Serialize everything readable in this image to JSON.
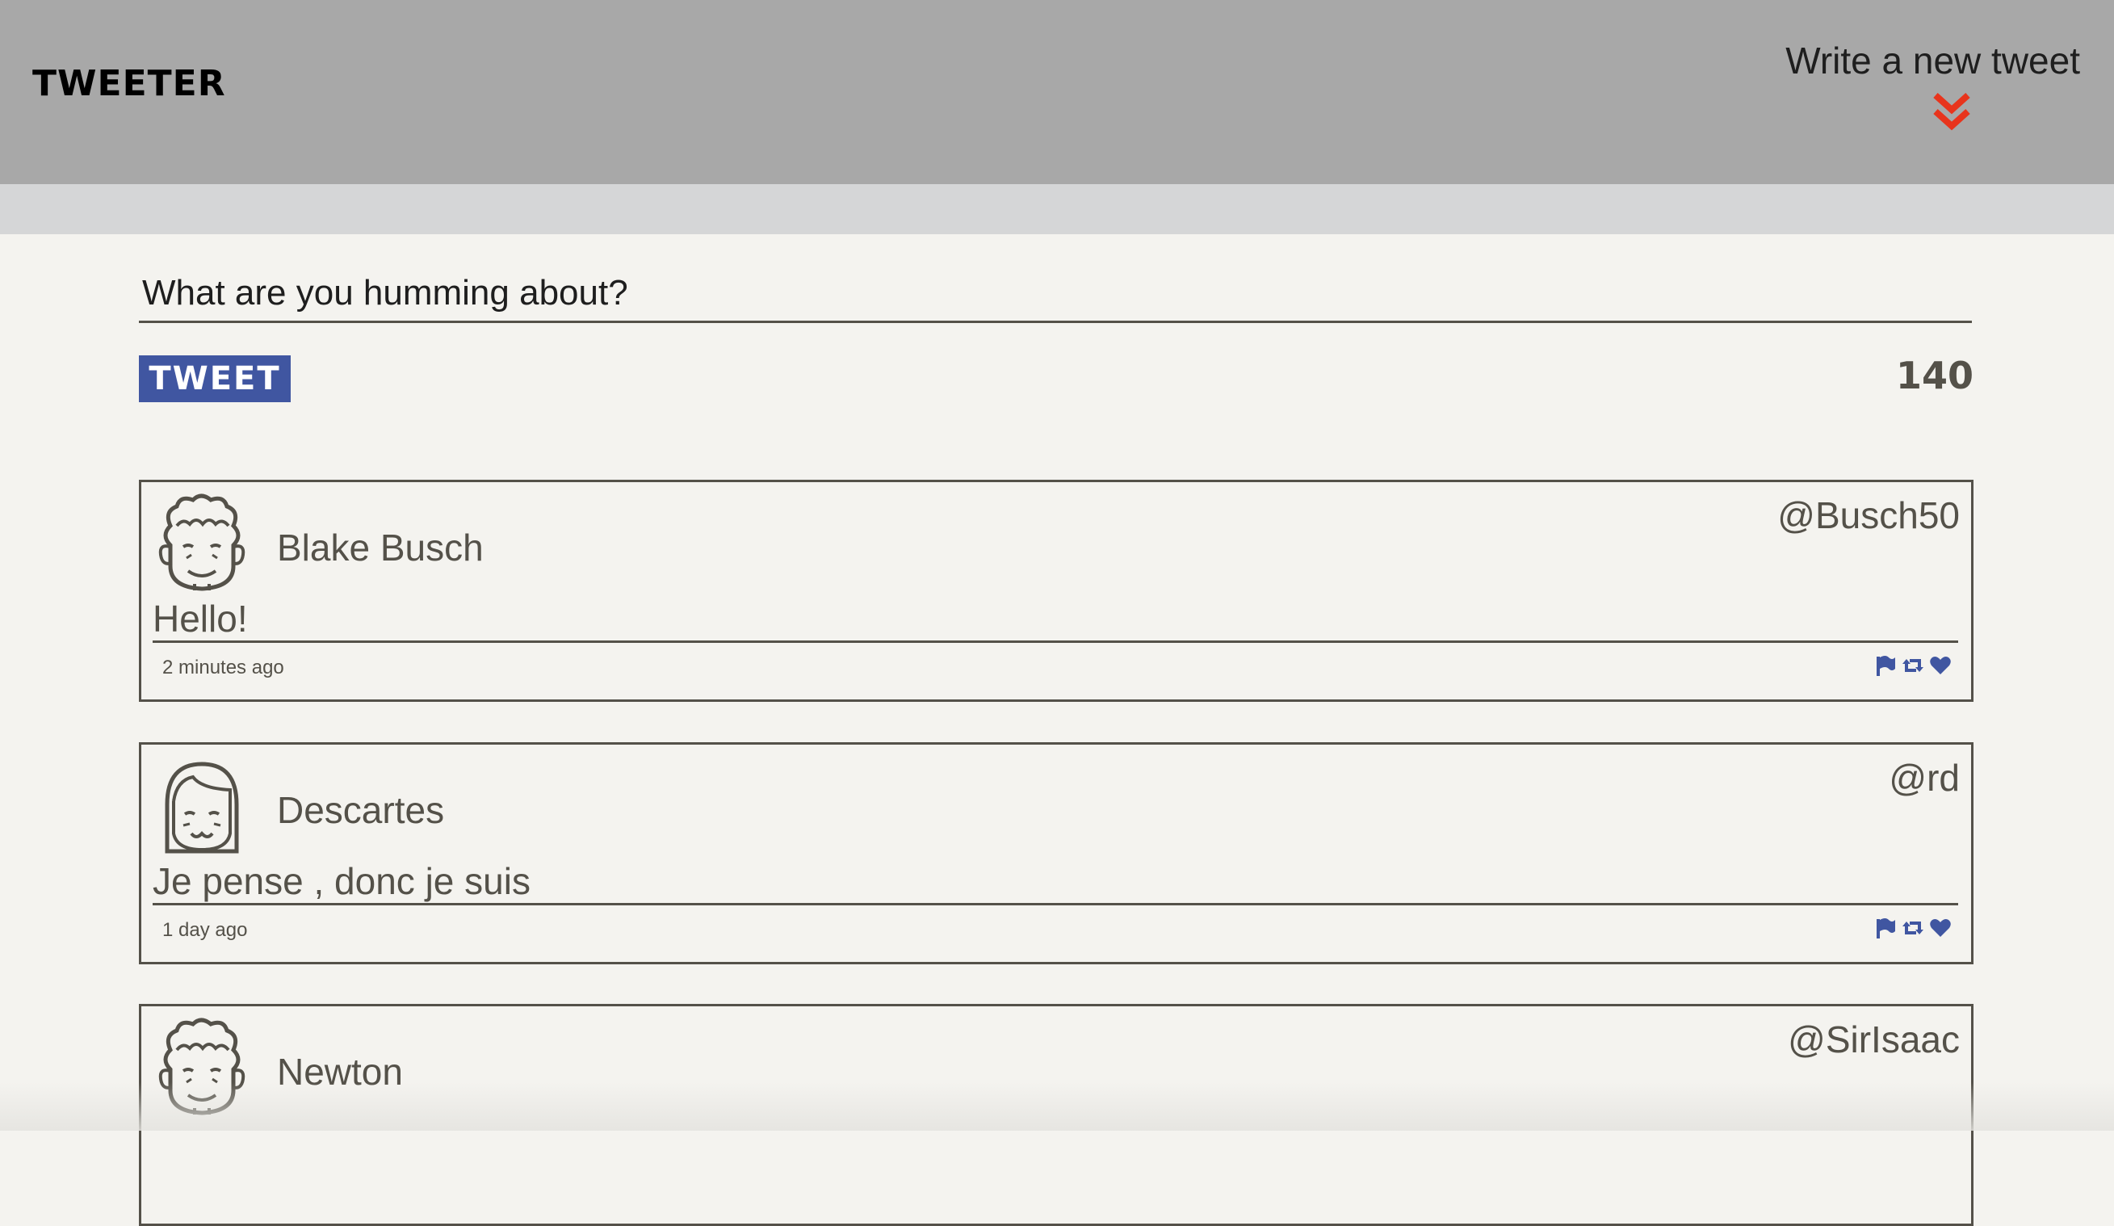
{
  "navbar": {
    "brand": "TWEETER",
    "compose_label": "Write a new tweet",
    "compose_icon": "double-chevron-down-icon",
    "accent_color": "#e8341c",
    "background": "#a8a8a8"
  },
  "new_tweet": {
    "placeholder": "What are you humming about?",
    "button_label": "TWEET",
    "counter": "140",
    "button_color": "#4056a1"
  },
  "tweets": [
    {
      "name": "Blake Busch",
      "handle": "@Busch50",
      "content": "Hello!",
      "time": "2 minutes ago",
      "avatar": "curly-hair-avatar-icon"
    },
    {
      "name": "Descartes",
      "handle": "@rd",
      "content": "Je pense , donc je suis",
      "time": "1 day ago",
      "avatar": "bob-hair-avatar-icon"
    },
    {
      "name": "Newton",
      "handle": "@SirIsaac",
      "content": "",
      "time": "",
      "avatar": "curly-hair-avatar-icon"
    }
  ],
  "actions": {
    "flag": "flag-icon",
    "retweet": "retweet-icon",
    "like": "heart-icon",
    "color": "#4056a1"
  }
}
